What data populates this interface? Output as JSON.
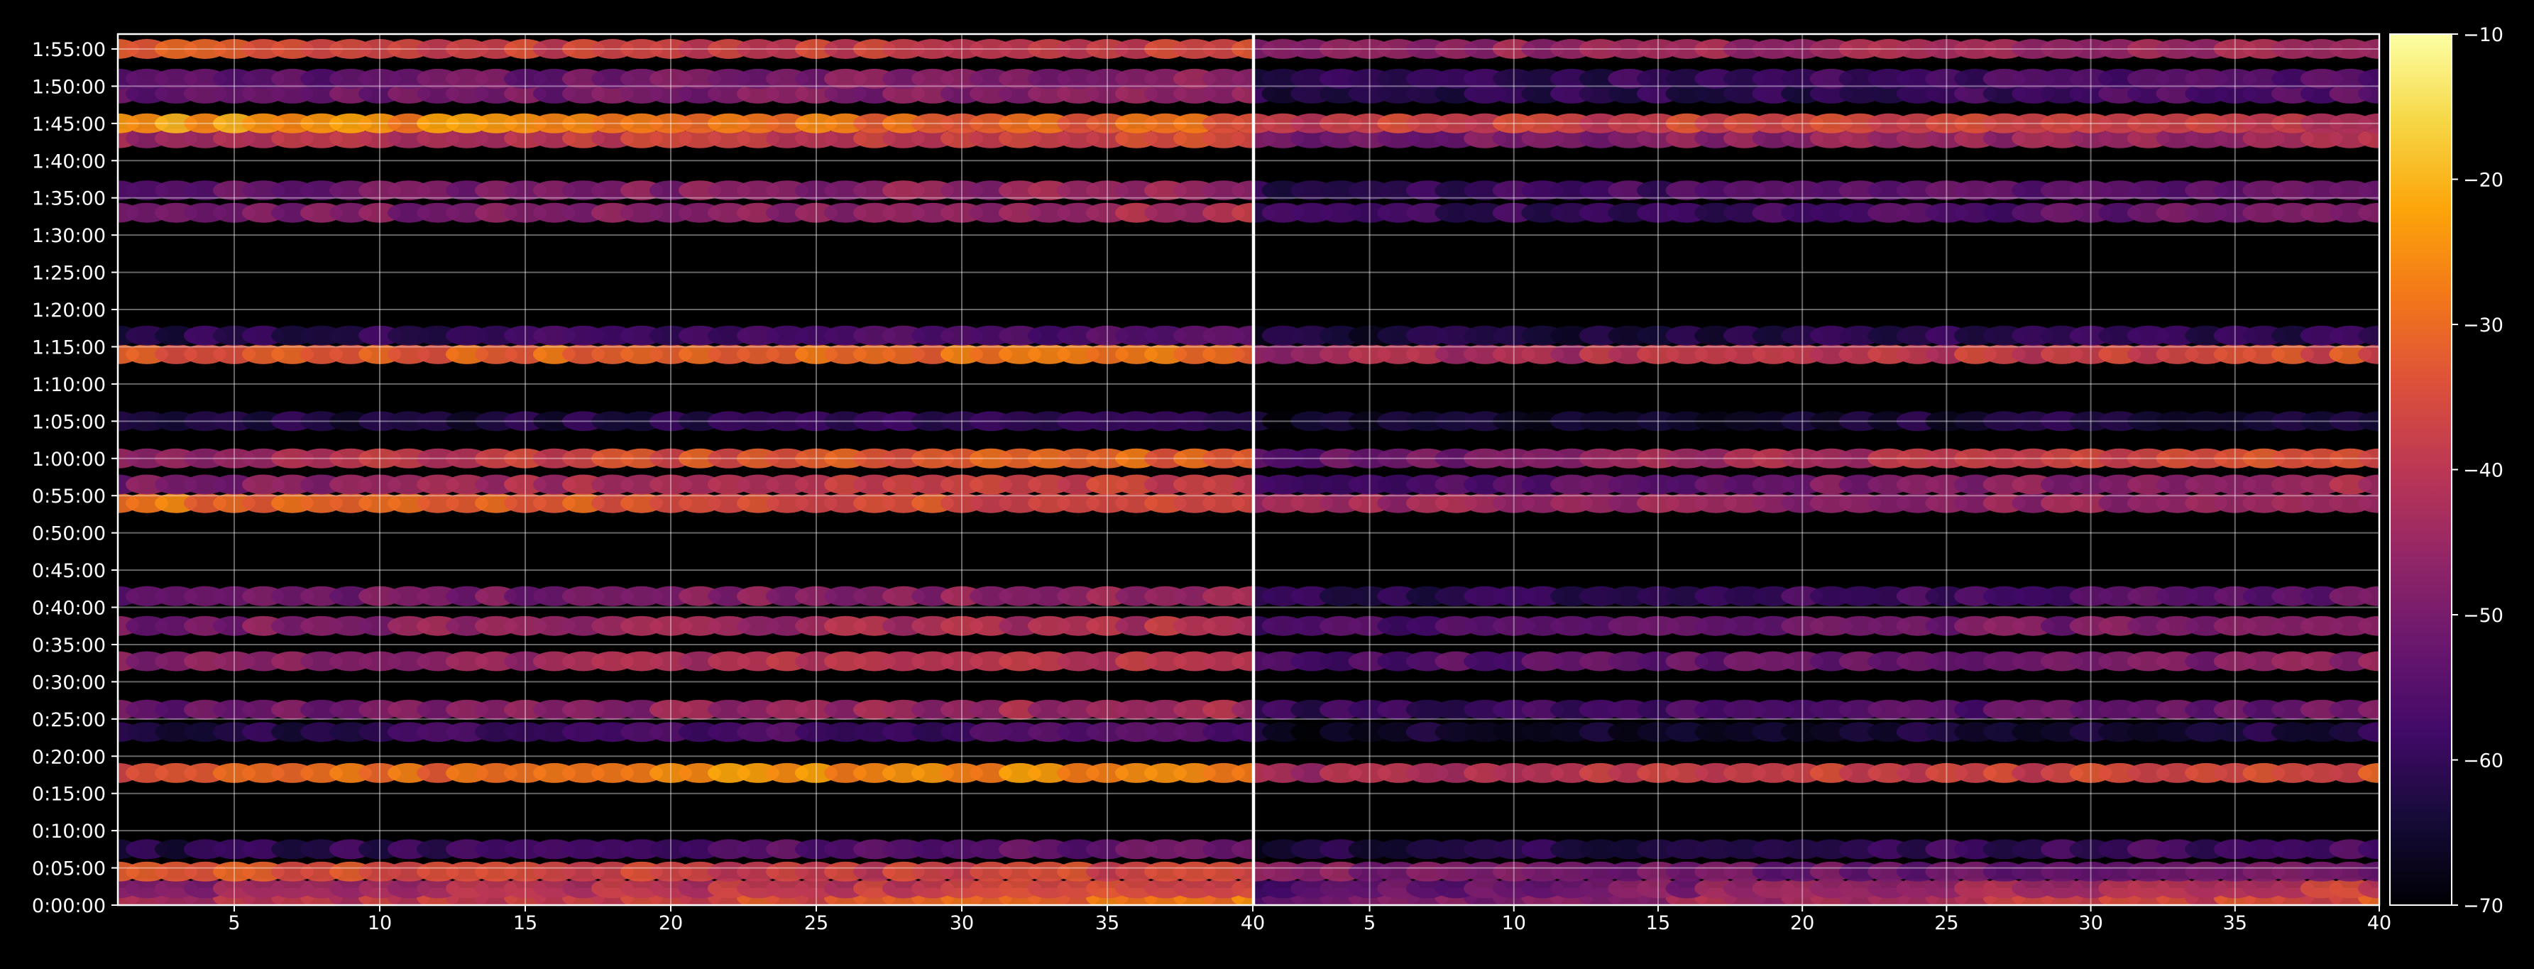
{
  "chart_data": {
    "type": "heatmap",
    "title": "",
    "xlabel": "",
    "ylabel": "",
    "colormap": "inferno",
    "panels": [
      {
        "xlim": [
          1,
          40
        ],
        "x_ticks": [
          "5",
          "10",
          "15",
          "20",
          "25",
          "30",
          "35"
        ]
      },
      {
        "xlim": [
          1,
          40
        ],
        "x_ticks": [
          "40",
          "5",
          "10",
          "15",
          "20",
          "25",
          "30",
          "35",
          "40"
        ]
      }
    ],
    "y_ticks": [
      "0:00:00",
      "0:05:00",
      "0:10:00",
      "0:15:00",
      "0:20:00",
      "0:25:00",
      "0:30:00",
      "0:35:00",
      "0:40:00",
      "0:45:00",
      "0:50:00",
      "0:55:00",
      "1:00:00",
      "1:05:00",
      "1:10:00",
      "1:15:00",
      "1:20:00",
      "1:25:00",
      "1:30:00",
      "1:35:00",
      "1:40:00",
      "1:45:00",
      "1:50:00",
      "1:55:00"
    ],
    "ylim_seconds": [
      0,
      7020
    ],
    "colorbar": {
      "range": [
        -70,
        -10
      ],
      "ticks": [
        "−70",
        "−60",
        "−50",
        "−40",
        "−30",
        "−20",
        "−10"
      ]
    },
    "grid": true,
    "bands": [
      {
        "t": 60,
        "p1": [
          -42,
          -36,
          -28
        ],
        "p2": [
          -52,
          -42,
          -34
        ]
      },
      {
        "t": 135,
        "p1": [
          -48,
          -40,
          -36
        ],
        "p2": [
          -56,
          -46,
          -38
        ]
      },
      {
        "t": 270,
        "p1": [
          -32,
          -38,
          -36
        ],
        "p2": [
          -48,
          -52,
          -50
        ]
      },
      {
        "t": 450,
        "p1": [
          -62,
          -56,
          -52
        ],
        "p2": [
          -64,
          -60,
          -56
        ]
      },
      {
        "t": 1065,
        "p1": [
          -34,
          -25,
          -26
        ],
        "p2": [
          -44,
          -38,
          -34
        ]
      },
      {
        "t": 1395,
        "p1": [
          -62,
          -58,
          -56
        ],
        "p2": [
          -66,
          -64,
          -62
        ]
      },
      {
        "t": 1575,
        "p1": [
          -52,
          -46,
          -42
        ],
        "p2": [
          -60,
          -56,
          -50
        ]
      },
      {
        "t": 1965,
        "p1": [
          -48,
          -42,
          -40
        ],
        "p2": [
          -56,
          -52,
          -46
        ]
      },
      {
        "t": 2250,
        "p1": [
          -50,
          -44,
          -40
        ],
        "p2": [
          -58,
          -52,
          -46
        ]
      },
      {
        "t": 2490,
        "p1": [
          -52,
          -48,
          -44
        ],
        "p2": [
          -62,
          -58,
          -52
        ]
      },
      {
        "t": 3240,
        "p1": [
          -28,
          -34,
          -36
        ],
        "p2": [
          -44,
          -46,
          -44
        ]
      },
      {
        "t": 3390,
        "p1": [
          -50,
          -40,
          -36
        ],
        "p2": [
          -58,
          -50,
          -42
        ]
      },
      {
        "t": 3600,
        "p1": [
          -46,
          -34,
          -30
        ],
        "p2": [
          -54,
          -42,
          -34
        ]
      },
      {
        "t": 3900,
        "p1": [
          -64,
          -62,
          -60
        ],
        "p2": [
          -66,
          -64,
          -62
        ]
      },
      {
        "t": 4440,
        "p1": [
          -34,
          -30,
          -28
        ],
        "p2": [
          -44,
          -40,
          -34
        ]
      },
      {
        "t": 4590,
        "p1": [
          -62,
          -58,
          -56
        ],
        "p2": [
          -64,
          -62,
          -60
        ]
      },
      {
        "t": 5580,
        "p1": [
          -50,
          -48,
          -42
        ],
        "p2": [
          -60,
          -58,
          -48
        ]
      },
      {
        "t": 5760,
        "p1": [
          -52,
          -48,
          -44
        ],
        "p2": [
          -60,
          -56,
          -50
        ]
      },
      {
        "t": 6180,
        "p1": [
          -44,
          -38,
          -36
        ],
        "p2": [
          -52,
          -46,
          -42
        ]
      },
      {
        "t": 6300,
        "p1": [
          -22,
          -28,
          -32
        ],
        "p2": [
          -38,
          -36,
          -40
        ]
      },
      {
        "t": 6540,
        "p1": [
          -52,
          -50,
          -46
        ],
        "p2": [
          -62,
          -60,
          -54
        ]
      },
      {
        "t": 6660,
        "p1": [
          -54,
          -50,
          -46
        ],
        "p2": [
          -62,
          -58,
          -54
        ]
      },
      {
        "t": 6900,
        "p1": [
          -32,
          -38,
          -36
        ],
        "p2": [
          -46,
          -44,
          -42
        ]
      }
    ]
  }
}
